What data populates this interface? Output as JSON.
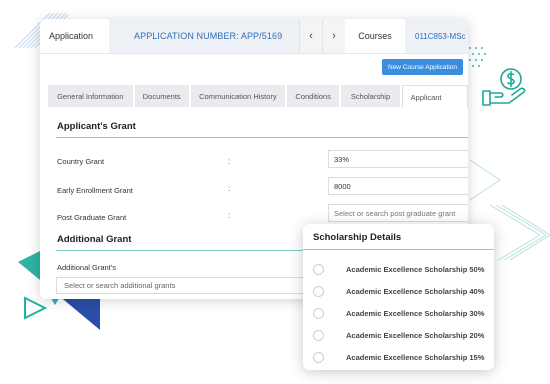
{
  "topbar": {
    "app_label": "Application",
    "application_number": "APPLICATION NUMBER: APP/5169",
    "prev_symbol": "‹",
    "next_symbol": "›",
    "courses_label": "Courses",
    "course_code": "011C853-MSc"
  },
  "actions": {
    "new_course_application": "New Course Application"
  },
  "tabs": [
    {
      "label": "General Information"
    },
    {
      "label": "Documents"
    },
    {
      "label": "Communication History"
    },
    {
      "label": "Conditions"
    },
    {
      "label": "Scholarship"
    },
    {
      "label": "Applicant"
    }
  ],
  "applicants_grant": {
    "title": "Applicant's Grant",
    "rows": [
      {
        "label": "Country Grant",
        "separator": ":",
        "value": "33%"
      },
      {
        "label": "Early Enrollment Grant",
        "separator": ":",
        "value": "8000"
      },
      {
        "label": "Post Graduate Grant",
        "separator": ":",
        "placeholder": "Select or search post graduate grant"
      }
    ]
  },
  "additional_grant": {
    "title": "Additional Grant",
    "label": "Additional Grant's",
    "placeholder": "Select or search additional grants"
  },
  "scholarship_details": {
    "title": "Scholarship Details",
    "items": [
      {
        "label": "Academic Excellence Scholarship 50%"
      },
      {
        "label": "Academic Excellence Scholarship 40%"
      },
      {
        "label": "Academic Excellence Scholarship 30%"
      },
      {
        "label": "Academic Excellence Scholarship 20%"
      },
      {
        "label": "Academic Excellence Scholarship 15%"
      }
    ]
  },
  "colors": {
    "accent_blue": "#2d6fb7",
    "button_blue": "#3b8de0",
    "teal": "#1fb3a3",
    "navy": "#2b4ea8"
  },
  "icons": [
    "hand-money-icon",
    "play-outline-icon"
  ]
}
